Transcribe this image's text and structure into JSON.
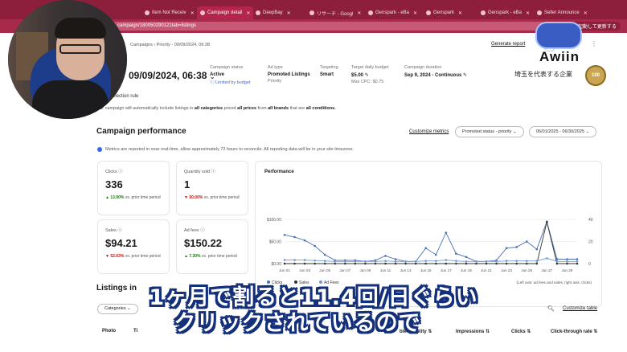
{
  "browser": {
    "tabs": [
      {
        "label": "Item Not Receiv",
        "active": false
      },
      {
        "label": "Campaign detail",
        "active": true
      },
      {
        "label": "DeepBay",
        "active": false
      },
      {
        "label": "リサーチ - Googl",
        "active": false
      },
      {
        "label": "Genspark - eBa",
        "active": false
      },
      {
        "label": "Genspark",
        "active": false
      },
      {
        "label": "Genspark - eBa",
        "active": false
      },
      {
        "label": "Seller Announce",
        "active": false
      }
    ],
    "url": "campaign/180050290121tab=listings",
    "update_label": "再起動して更新する"
  },
  "header": {
    "breadcrumb": "Campaigns  ›  Priority - 09/09/2024, 06:38",
    "generate_report": "Generate report",
    "campaign_date": "09/09/2024, 06:38"
  },
  "info": {
    "status_label": "Campaign status",
    "status_value": "Active",
    "status_link": "Limited by budget",
    "adtype_label": "Ad type",
    "adtype_value": "Promoted Listings",
    "adtype_sub": "Priority",
    "targeting_label": "Targeting",
    "targeting_value": "Smart",
    "budget_label": "Target daily budget",
    "budget_value": "$5.00",
    "budget_sub": "Max CPC: $0.75",
    "duration_label": "Campaign duration",
    "duration_value": "Sep 9, 2024 - Continuous"
  },
  "rule": {
    "title": "Listing selection rule",
    "text_a": "Your campaign will automatically include listings in ",
    "text_b": "all categories",
    "text_c": " priced ",
    "text_d": "all prices",
    "text_e": " from ",
    "text_f": "all brands",
    "text_g": " that are ",
    "text_h": "all conditions."
  },
  "performance": {
    "title": "Campaign performance",
    "customize_metrics": "Customize metrics",
    "status_filter": "Promoted status - priority",
    "date_range": "06/01/2025 - 06/30/2025",
    "note": "Metrics are reported in near real-time, allow approximately 72 hours to reconcile. All reporting data will be in your site timezone."
  },
  "cards": [
    {
      "label": "Clicks",
      "value": "336",
      "change": "13.90%",
      "direction": "up",
      "suffix": "vs. prior time period"
    },
    {
      "label": "Quantity sold",
      "value": "1",
      "change": "50.00%",
      "direction": "down",
      "suffix": "vs. prior time period"
    },
    {
      "label": "Sales",
      "value": "$94.21",
      "change": "52.63%",
      "direction": "down",
      "suffix": "vs. prior time period"
    },
    {
      "label": "Ad fees",
      "value": "$150.22",
      "change": "7.30%",
      "direction": "up",
      "suffix": "vs. prior time period"
    }
  ],
  "chart_data": {
    "type": "line",
    "title": "Performance",
    "x": [
      "Jun 01",
      "Jun 02",
      "Jun 03",
      "Jun 04",
      "Jun 05",
      "Jun 06",
      "Jun 07",
      "Jun 08",
      "Jun 09",
      "Jun 10",
      "Jun 11",
      "Jun 12",
      "Jun 13",
      "Jun 14",
      "Jun 15",
      "Jun 16",
      "Jun 17",
      "Jun 18",
      "Jun 19",
      "Jun 20",
      "Jun 21",
      "Jun 22",
      "Jun 23",
      "Jun 24",
      "Jun 25",
      "Jun 26",
      "Jun 27",
      "Jun 28",
      "Jun 29",
      "Jun 30"
    ],
    "x_tick_labels": [
      "Jun 01",
      "Jun 03",
      "Jun 05",
      "Jun 07",
      "Jun 09",
      "Jun 11",
      "Jun 13",
      "Jun 15",
      "Jun 17",
      "Jun 19",
      "Jun 21",
      "Jun 23",
      "Jun 25",
      "Jun 27",
      "Jun 29"
    ],
    "y_left_ticks": [
      "$100.00",
      "$50.00",
      "$0.00"
    ],
    "y_left_lim": [
      0,
      100
    ],
    "y_right_ticks": [
      "40",
      "20",
      "0"
    ],
    "y_right_lim": [
      0,
      40
    ],
    "series": [
      {
        "name": "Clicks",
        "axis": "right",
        "color": "#4a6fb3",
        "values": [
          26,
          24,
          21,
          16,
          8,
          3,
          3,
          3,
          2,
          3,
          7,
          4,
          2,
          2,
          14,
          8,
          28,
          9,
          6,
          2,
          2,
          3,
          14,
          15,
          20,
          13,
          38,
          4,
          4,
          4
        ]
      },
      {
        "name": "Sales",
        "axis": "left",
        "color": "#333333",
        "values": [
          0,
          0,
          0,
          0,
          0,
          0,
          0,
          0,
          0,
          0,
          0,
          0,
          0,
          0,
          0,
          0,
          0,
          0,
          0,
          0,
          0,
          0,
          0,
          0,
          0,
          0,
          94.21,
          0,
          0,
          0
        ]
      },
      {
        "name": "Ad Fees",
        "axis": "left",
        "color": "#6f9bd1",
        "values": [
          8,
          8,
          8,
          7,
          6,
          5,
          5,
          5,
          5,
          5,
          6,
          5,
          5,
          5,
          6,
          6,
          8,
          6,
          5,
          5,
          5,
          5,
          6,
          6,
          6,
          6,
          12,
          5,
          5,
          5
        ]
      }
    ],
    "footnote": "(Left axis: ad fees and sales; right axis: clicks)"
  },
  "listings": {
    "title": "Listings in",
    "categories_label": "Categories",
    "customize_table": "Customize table",
    "columns": [
      "Photo",
      "Ti",
      "ble quantity",
      "Impressions",
      "Clicks",
      "Click-through rate"
    ]
  },
  "overlay": {
    "logo_text": "Awiin",
    "logo_sub": "埼玉を代表する企業",
    "badge": "100",
    "subtitle_line1": "1ヶ月で割ると11.4回/日ぐらい",
    "subtitle_line2": "クリックされているので"
  }
}
